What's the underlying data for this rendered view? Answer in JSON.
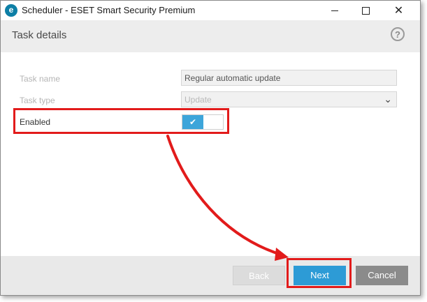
{
  "window": {
    "title": "Scheduler - ESET Smart Security Premium",
    "app_icon_letter": "e"
  },
  "header": {
    "title": "Task details",
    "help_symbol": "?"
  },
  "form": {
    "task_name_label": "Task name",
    "task_name_value": "Regular automatic update",
    "task_type_label": "Task type",
    "task_type_value": "Update",
    "enabled_label": "Enabled",
    "enabled_state": true
  },
  "footer": {
    "back_label": "Back",
    "next_label": "Next",
    "cancel_label": "Cancel"
  },
  "colors": {
    "accent": "#2d9bd6",
    "annotation": "#e21b1b",
    "toggle_on": "#3da5da"
  }
}
